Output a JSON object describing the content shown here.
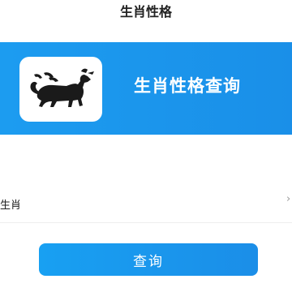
{
  "nav": {
    "title": "生肖性格"
  },
  "banner": {
    "logo_icon": "qilin-icon",
    "title": "生肖性格查询",
    "color": "#1c9cf0"
  },
  "form": {
    "zodiac_label": "生肖",
    "arrow_icon": "chevron-right-icon"
  },
  "actions": {
    "query_label": "查询"
  }
}
